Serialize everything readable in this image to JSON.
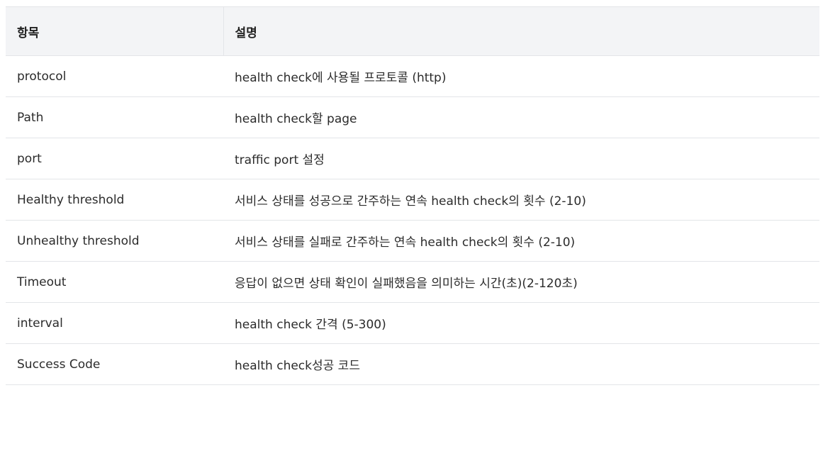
{
  "table": {
    "headers": [
      "항목",
      "설명"
    ],
    "rows": [
      {
        "item": "protocol",
        "desc": "health check에 사용될 프로토콜 (http)"
      },
      {
        "item": "Path",
        "desc": "health check할 page"
      },
      {
        "item": "port",
        "desc": "traffic port 설정"
      },
      {
        "item": "Healthy threshold",
        "desc": "서비스 상태를 성공으로 간주하는 연속 health check의 횟수 (2-10)"
      },
      {
        "item": "Unhealthy threshold",
        "desc": "서비스 상태를 실패로 간주하는 연속 health check의 횟수 (2-10)"
      },
      {
        "item": "Timeout",
        "desc": "응답이 없으면 상태 확인이 실패했음을 의미하는 시간(초)(2-120초)"
      },
      {
        "item": "interval",
        "desc": "health check 간격 (5-300)"
      },
      {
        "item": "Success Code",
        "desc": "health check성공 코드"
      }
    ]
  }
}
